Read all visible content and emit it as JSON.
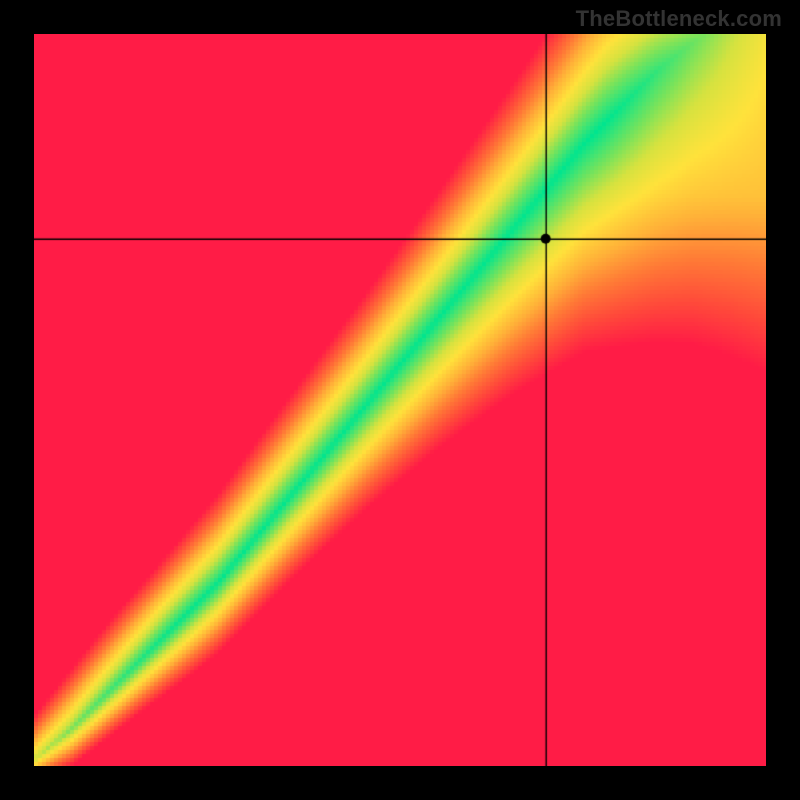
{
  "watermark": "TheBottleneck.com",
  "chart_data": {
    "type": "heatmap",
    "title": "",
    "xlabel": "",
    "ylabel": "",
    "xlim": [
      0,
      1
    ],
    "ylim": [
      0,
      1
    ],
    "crosshair": {
      "x": 0.7,
      "y": 0.72
    },
    "ridge": {
      "description": "Green optimal band along a diagonal curve; band width varies with position",
      "points": [
        {
          "x": 0.0,
          "y": 0.01,
          "half_width": 0.016
        },
        {
          "x": 0.05,
          "y": 0.05,
          "half_width": 0.02
        },
        {
          "x": 0.1,
          "y": 0.1,
          "half_width": 0.022
        },
        {
          "x": 0.15,
          "y": 0.15,
          "half_width": 0.024
        },
        {
          "x": 0.2,
          "y": 0.2,
          "half_width": 0.027
        },
        {
          "x": 0.25,
          "y": 0.25,
          "half_width": 0.03
        },
        {
          "x": 0.3,
          "y": 0.31,
          "half_width": 0.033
        },
        {
          "x": 0.35,
          "y": 0.37,
          "half_width": 0.036
        },
        {
          "x": 0.4,
          "y": 0.43,
          "half_width": 0.039
        },
        {
          "x": 0.45,
          "y": 0.49,
          "half_width": 0.042
        },
        {
          "x": 0.5,
          "y": 0.55,
          "half_width": 0.046
        },
        {
          "x": 0.55,
          "y": 0.61,
          "half_width": 0.05
        },
        {
          "x": 0.6,
          "y": 0.67,
          "half_width": 0.055
        },
        {
          "x": 0.65,
          "y": 0.73,
          "half_width": 0.06
        },
        {
          "x": 0.7,
          "y": 0.79,
          "half_width": 0.066
        },
        {
          "x": 0.75,
          "y": 0.85,
          "half_width": 0.072
        },
        {
          "x": 0.8,
          "y": 0.9,
          "half_width": 0.08
        },
        {
          "x": 0.85,
          "y": 0.95,
          "half_width": 0.088
        },
        {
          "x": 0.9,
          "y": 0.99,
          "half_width": 0.095
        },
        {
          "x": 0.95,
          "y": 1.02,
          "half_width": 0.102
        },
        {
          "x": 1.0,
          "y": 1.05,
          "half_width": 0.11
        }
      ]
    },
    "color_stops": [
      {
        "t": 0.0,
        "color": "#00e58f"
      },
      {
        "t": 0.18,
        "color": "#7be35a"
      },
      {
        "t": 0.3,
        "color": "#d6e23f"
      },
      {
        "t": 0.42,
        "color": "#ffe23b"
      },
      {
        "t": 0.58,
        "color": "#ffb138"
      },
      {
        "t": 0.72,
        "color": "#ff7a36"
      },
      {
        "t": 0.86,
        "color": "#ff4a3a"
      },
      {
        "t": 1.0,
        "color": "#ff1c46"
      }
    ]
  }
}
